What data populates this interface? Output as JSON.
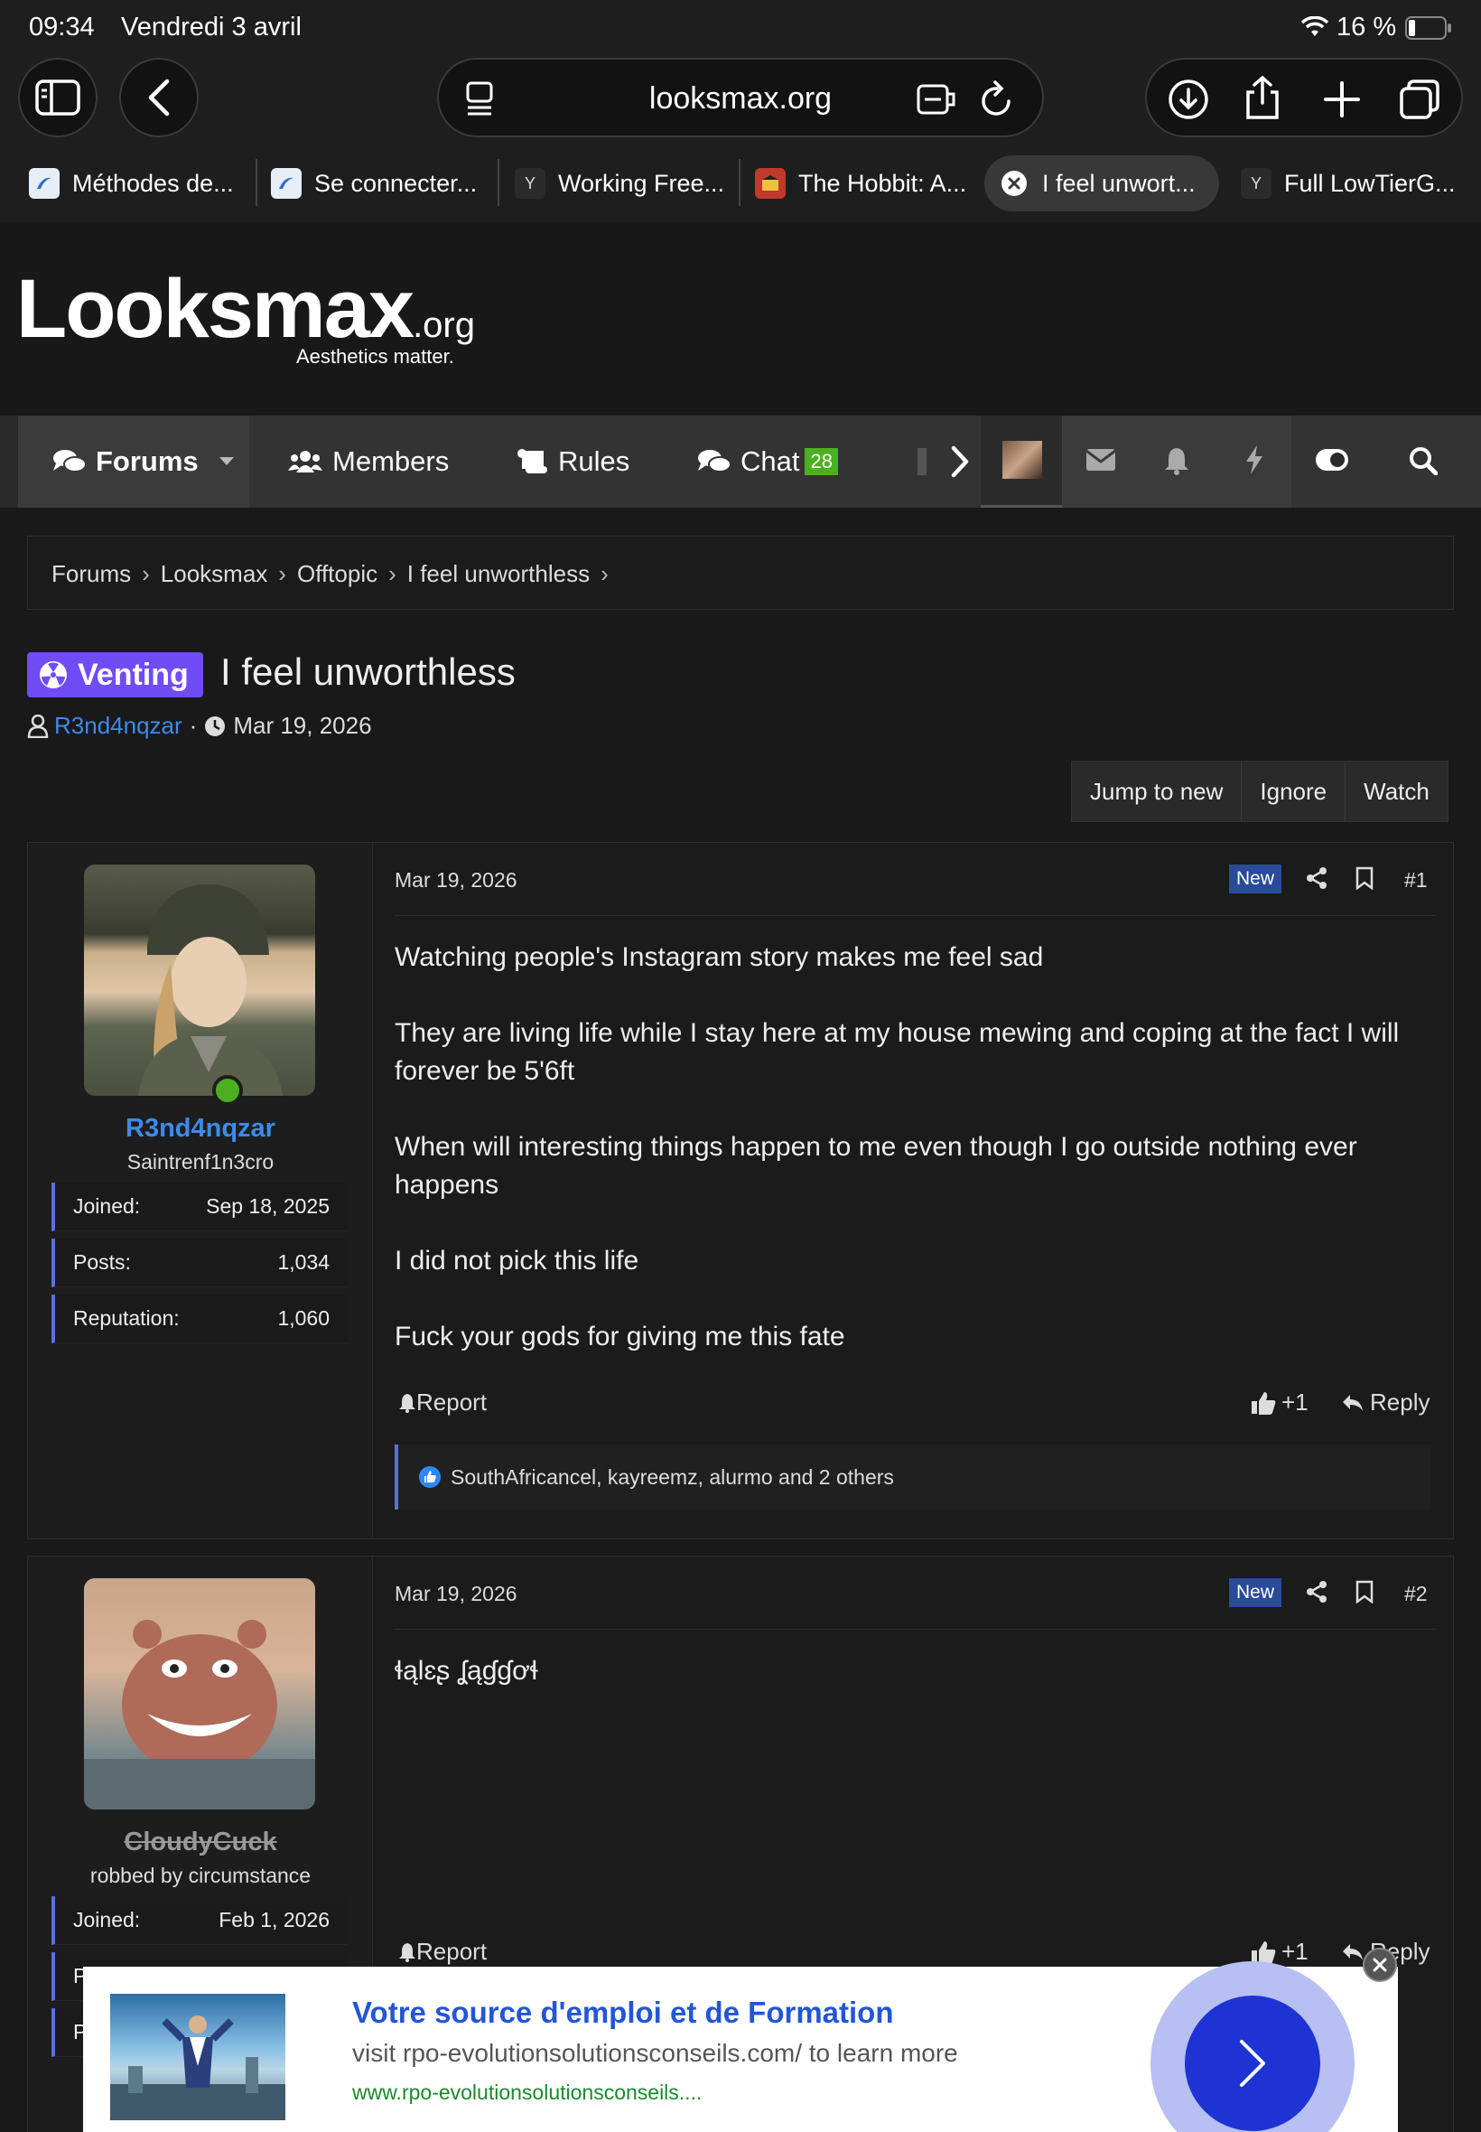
{
  "status": {
    "time": "09:34",
    "date": "Vendredi 3 avril",
    "battery": "16 %"
  },
  "browser": {
    "url": "looksmax.org",
    "tabs": [
      {
        "label": "Méthodes de..."
      },
      {
        "label": "Se connecter..."
      },
      {
        "label": "Working Free...",
        "fav": "Y"
      },
      {
        "label": "The Hobbit: A..."
      },
      {
        "label": "I feel unwort..."
      },
      {
        "label": "Full LowTierG...",
        "fav": "Y"
      }
    ]
  },
  "site": {
    "logo": "Looksmax",
    "logo_suffix": ".org",
    "tagline": "Aesthetics matter."
  },
  "nav": {
    "forums": "Forums",
    "members": "Members",
    "rules": "Rules",
    "chat": "Chat",
    "chat_badge": "28"
  },
  "breadcrumb": [
    "Forums",
    "Looksmax",
    "Offtopic",
    "I feel unworthless"
  ],
  "thread": {
    "prefix": "Venting",
    "title": "I feel unworthless",
    "author": "R3nd4nqzar",
    "date": "Mar 19, 2026",
    "sep": "·",
    "actions": {
      "jump": "Jump to new",
      "ignore": "Ignore",
      "watch": "Watch"
    }
  },
  "posts": [
    {
      "username": "R3nd4nqzar",
      "user_title": "Saintrenf1n3cro",
      "stats": [
        {
          "label": "Joined:",
          "value": "Sep 18, 2025"
        },
        {
          "label": "Posts:",
          "value": "1,034"
        },
        {
          "label": "Reputation:",
          "value": "1,060"
        }
      ],
      "date": "Mar 19, 2026",
      "new_label": "New",
      "number": "#1",
      "body": [
        "Watching people's Instagram story makes me feel sad",
        "They are living life while I stay here at my house mewing and coping at the fact I will forever be 5'6ft",
        "When will interesting things happen to me even though I go outside nothing ever happens",
        "I did not pick this life",
        "Fuck your gods for giving me this fate"
      ],
      "report": "Report",
      "plus": "+1",
      "reply": "Reply",
      "likes": "SouthAfricancel, kayreemz, alurmo and 2 others"
    },
    {
      "username": "CloudyCuck",
      "user_title": "robbed by circumstance",
      "stats": [
        {
          "label": "Joined:",
          "value": "Feb 1, 2026"
        },
        {
          "label": "P",
          "value": ""
        },
        {
          "label": "P",
          "value": ""
        }
      ],
      "date": "Mar 19, 2026",
      "new_label": "New",
      "number": "#2",
      "body": [
        "ɬąƖɛʂ ʆąɠɠơɬ"
      ],
      "report": "Report",
      "plus": "+1",
      "reply": "Reply"
    }
  ],
  "ad": {
    "title": "Votre source d'emploi et de Formation",
    "subtitle": "visit rpo-evolutionsolutionsconseils.com/ to learn more",
    "url": "www.rpo-evolutionsolutionsconseils...."
  },
  "colors": {
    "accent": "#3d8be8",
    "prefix": "#6f4cf5",
    "online": "#4caf1f",
    "ad_button": "#1d33d4"
  }
}
